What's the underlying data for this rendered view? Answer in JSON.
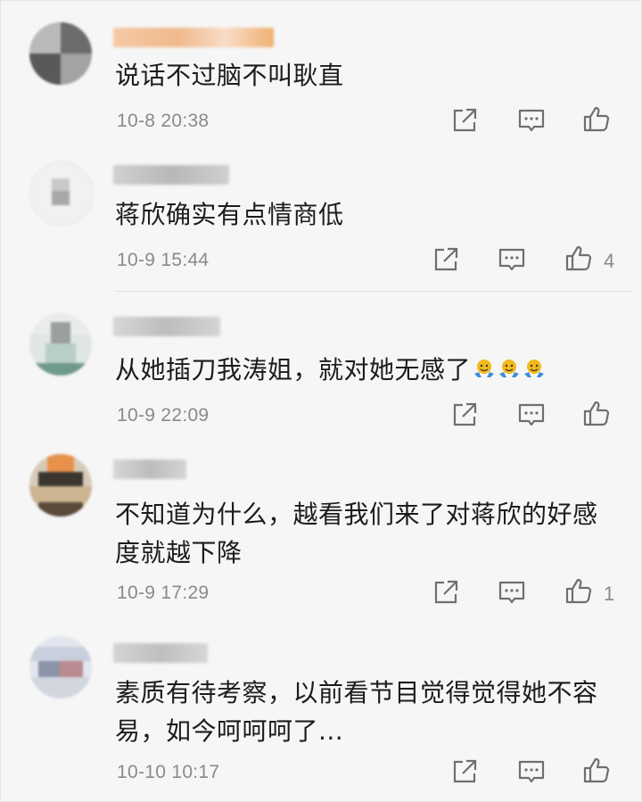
{
  "comments": [
    {
      "text": "说话不过脑不叫耿直",
      "time": "10-8 20:38",
      "likes": ""
    },
    {
      "text": "蒋欣确实有点情商低",
      "time": "10-9 15:44",
      "likes": "4"
    },
    {
      "text": "从她插刀我涛姐，就对她无感了",
      "time": "10-9 22:09",
      "likes": "",
      "emoji_count": 3
    },
    {
      "text_line1": "不知道为什么，越看我们来了对蒋欣的好感",
      "text_line2": "度就越下降",
      "time": "10-9 17:29",
      "likes": "1"
    },
    {
      "text_line1": "素质有待考察，以前看节目觉得觉得她不容",
      "text_line2": "易，如今呵呵呵了...",
      "time": "10-10 10:17",
      "likes": ""
    }
  ],
  "icons": {
    "share": "share-icon",
    "reply": "comment-icon",
    "like": "thumbs-up-icon",
    "emoji": "shrug-emoji-icon"
  },
  "colors": {
    "text": "#1c1c1c",
    "meta": "#8a8a8a",
    "icon": "#6f6f6f",
    "background": "#f6f6f6",
    "emoji": "#f2b81c"
  }
}
